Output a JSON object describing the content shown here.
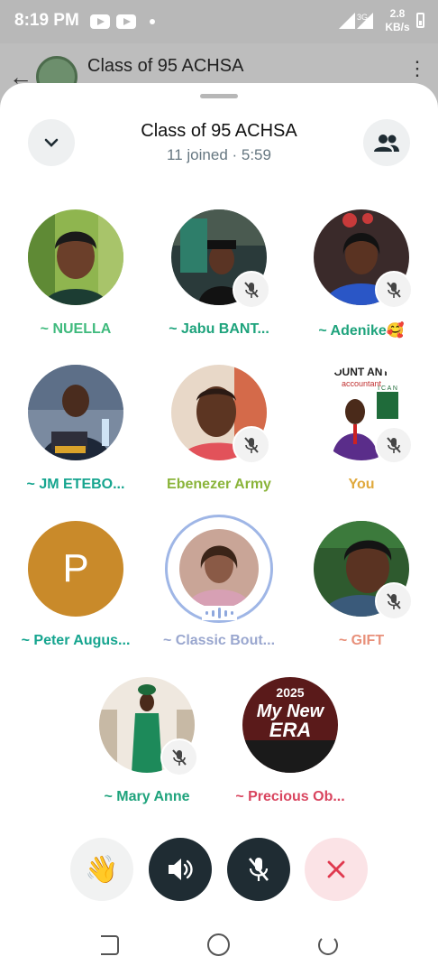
{
  "status_bar": {
    "time": "8:19 PM",
    "network_label": "3G",
    "speed_value": "2.8",
    "speed_unit": "KB/s"
  },
  "background_chat": {
    "title": "Class of 95 ACHSA"
  },
  "call": {
    "title": "Class of 95 ACHSA",
    "subtitle": "11 joined · 5:59"
  },
  "participants": [
    {
      "name": "~ NUELLA",
      "color": "#3fba7d",
      "muted": false
    },
    {
      "name": "~ Jabu BANT...",
      "color": "#1ea37c",
      "muted": true
    },
    {
      "name": "~ Adenike🥰",
      "color": "#1ea37c",
      "muted": true
    },
    {
      "name": "~ JM ETEBO...",
      "color": "#16a58f",
      "muted": false
    },
    {
      "name": "Ebenezer Army",
      "color": "#8ab43a",
      "muted": true
    },
    {
      "name": "You",
      "color": "#e0a93d",
      "muted": true
    },
    {
      "name": "~ Peter Augus...",
      "color": "#16a58f",
      "muted": false,
      "initial": "P"
    },
    {
      "name": "~ Classic Bout...",
      "color": "#9aa7cf",
      "muted": false,
      "speaking": true
    },
    {
      "name": "~ GIFT",
      "color": "#e8907a",
      "muted": true
    },
    {
      "name": "~ Mary Anne",
      "color": "#1ea37c",
      "muted": true
    },
    {
      "name": "~ Precious Ob...",
      "color": "#d9455f",
      "muted": false
    }
  ],
  "controls": {
    "raise_hand_emoji": "👋"
  },
  "avatar_art": {
    "you_banner_text": "OUNT ANT",
    "you_banner_sub": "accountant",
    "you_logo_text": "I C A N",
    "precious_year": "2025",
    "precious_line1": "My New",
    "precious_line2": "ERA"
  }
}
